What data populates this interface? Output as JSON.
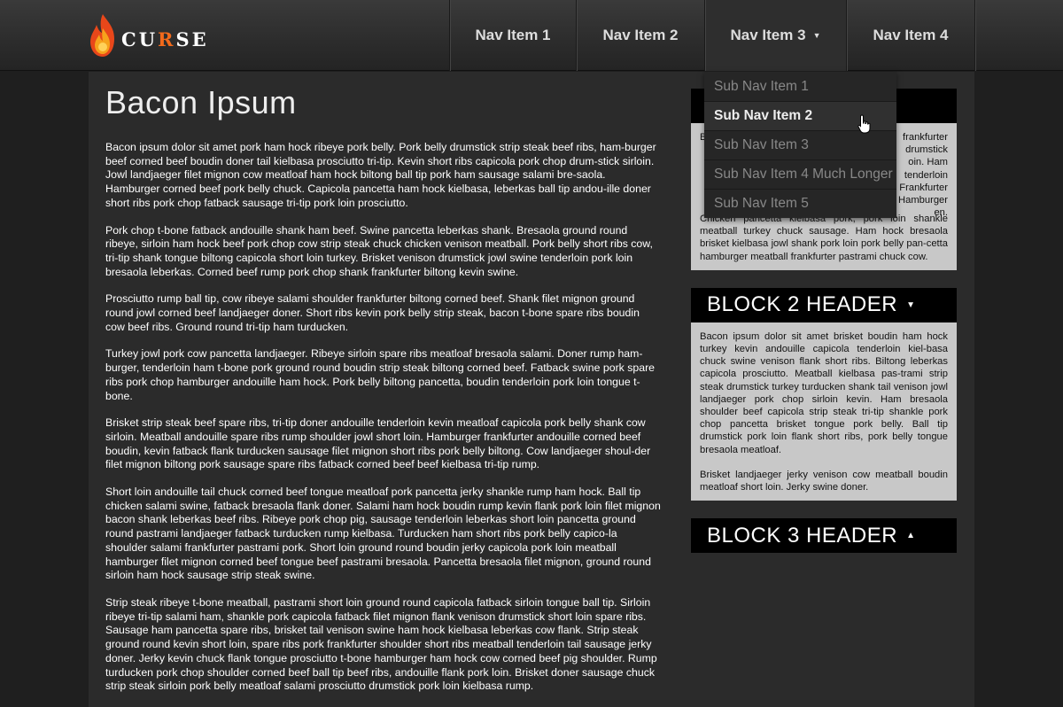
{
  "header": {
    "logo_text_pre": "CU",
    "logo_text_accent": "R",
    "logo_text_post": "SE",
    "nav": [
      {
        "label": "Nav Item 1"
      },
      {
        "label": "Nav Item 2"
      },
      {
        "label": "Nav Item 3",
        "caret": "▼"
      },
      {
        "label": "Nav Item 4"
      }
    ]
  },
  "dropdown": {
    "items": [
      {
        "label": "Sub Nav Item 1"
      },
      {
        "label": "Sub Nav Item 2"
      },
      {
        "label": "Sub Nav Item 3"
      },
      {
        "label": "Sub Nav Item 4 Much Longer"
      },
      {
        "label": "Sub Nav Item 5"
      }
    ]
  },
  "main": {
    "title": "Bacon Ipsum",
    "paragraphs": [
      "Bacon ipsum dolor sit amet pork ham hock ribeye pork belly. Pork belly drumstick strip steak beef ribs, ham-burger beef corned beef boudin doner tail kielbasa prosciutto tri-tip. Kevin short ribs capicola pork chop drum-stick sirloin. Jowl landjaeger filet mignon cow meatloaf ham hock biltong ball tip pork ham sausage salami bre-saola. Hamburger corned beef pork belly chuck. Capicola pancetta ham hock kielbasa, leberkas ball tip andou-ille doner short ribs pork chop fatback sausage tri-tip pork loin prosciutto.",
      "Pork chop t-bone fatback andouille shank ham beef. Swine pancetta leberkas shank. Bresaola ground round ribeye, sirloin ham hock beef pork chop cow strip steak chuck chicken venison meatball. Pork belly short ribs cow, tri-tip shank tongue biltong capicola short loin turkey. Brisket venison drumstick jowl swine tenderloin pork loin bresaola leberkas. Corned beef rump pork chop shank frankfurter biltong kevin swine.",
      "Prosciutto rump ball tip, cow ribeye salami shoulder frankfurter biltong corned beef. Shank filet mignon ground round jowl corned beef landjaeger doner. Short ribs kevin pork belly strip steak, bacon t-bone spare ribs boudin cow beef ribs. Ground round tri-tip ham turducken.",
      "Turkey jowl pork cow pancetta landjaeger. Ribeye sirloin spare ribs meatloaf bresaola salami. Doner rump ham-burger, tenderloin ham t-bone pork ground round boudin strip steak biltong corned beef. Fatback swine pork spare ribs pork chop hamburger andouille ham hock. Pork belly biltong pancetta, boudin tenderloin pork loin tongue t-bone.",
      "Brisket strip steak beef spare ribs, tri-tip doner andouille tenderloin kevin meatloaf capicola pork belly shank cow sirloin. Meatball andouille spare ribs rump shoulder jowl short loin. Hamburger frankfurter andouille corned beef boudin, kevin fatback flank turducken sausage filet mignon short ribs pork belly biltong. Cow landjaeger shoul-der filet mignon biltong pork sausage spare ribs fatback corned beef beef kielbasa tri-tip rump.",
      "Short loin andouille tail chuck corned beef tongue meatloaf pork pancetta jerky shankle rump ham hock. Ball tip chicken salami swine, fatback bresaola flank doner. Salami ham hock boudin rump kevin flank pork loin filet mignon bacon shank leberkas beef ribs. Ribeye pork chop pig, sausage tenderloin leberkas short loin pancetta ground round pastrami landjaeger fatback turducken rump kielbasa. Turducken ham short ribs pork belly capico-la shoulder salami frankfurter pastrami pork. Short loin ground round boudin jerky capicola pork loin meatball hamburger filet mignon corned beef tongue beef pastrami bresaola. Pancetta bresaola filet mignon, ground round sirloin ham hock sausage strip steak swine.",
      "Strip steak ribeye t-bone meatball, pastrami short loin ground round capicola fatback sirloin tongue ball tip. Sirloin ribeye tri-tip salami ham, shankle pork capicola fatback filet mignon flank venison drumstick short loin spare ribs. Sausage ham pancetta spare ribs, brisket tail venison swine ham hock kielbasa leberkas cow flank. Strip steak ground round kevin short loin, spare ribs pork frankfurter shoulder short ribs meatball tenderloin tail sausage jerky doner. Jerky kevin chuck flank tongue prosciutto t-bone hamburger ham hock cow corned beef pig shoulder. Rump turducken pork chop shoulder corned beef ball tip beef ribs, andouille flank pork loin. Brisket doner sausage chuck strip steak sirloin pork belly meatloaf salami prosciutto drumstick pork loin kielbasa rump."
    ]
  },
  "sidebar": {
    "block1": {
      "body_line1_visible": "B",
      "body_right": "frankfurter drumstick oin. Ham tenderloin Frankfurter Hamburger en.",
      "body_paragraph2": "Chicken pancetta kielbasa pork, pork loin shankle meatball turkey chuck sausage. Ham hock bresaola brisket kielbasa jowl shank pork loin pork belly pan-cetta hamburger meatball frankfurter pastrami chuck cow."
    },
    "block2": {
      "header": "BLOCK 2 HEADER",
      "caret": "▼",
      "paragraphs": [
        "Bacon ipsum dolor sit amet brisket boudin ham hock turkey kevin andouille capicola tenderloin kiel-basa chuck swine venison flank short ribs. Biltong leberkas capicola prosciutto. Meatball kielbasa pas-trami strip steak drumstick turkey turducken shank tail venison jowl landjaeger pork chop sirloin kevin. Ham bresaola shoulder beef capicola strip steak tri-tip shankle pork chop pancetta brisket tongue pork belly. Ball tip drumstick pork loin flank short ribs, pork belly tongue bresaola meatloaf.",
        "Brisket landjaeger jerky venison cow meatball boudin meatloaf short loin. Jerky swine doner."
      ]
    },
    "block3": {
      "header": "BLOCK 3 HEADER",
      "caret": "▲"
    }
  },
  "colors": {
    "accent": "#f26a1b",
    "page_bg": "#1f1f1f",
    "panel_bg": "#2b2b2b",
    "block_header_bg": "#000000",
    "block_body_bg": "#c8c8c8"
  },
  "icons": [
    "flame-logo-icon",
    "caret-down-icon",
    "caret-up-icon",
    "hand-pointer-icon"
  ]
}
